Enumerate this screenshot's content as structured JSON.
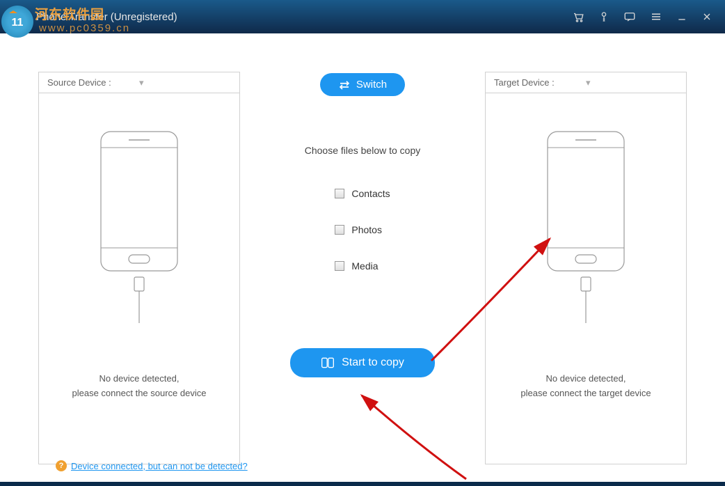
{
  "window": {
    "title": "Phone Transfer (Unregistered)"
  },
  "watermark": {
    "text": "河东软件园",
    "url": "www.pc0359.cn",
    "logoNum": "11"
  },
  "source": {
    "selectLabel": "Source Device :",
    "statusLine1": "No device detected,",
    "statusLine2": "please connect the source device"
  },
  "target": {
    "selectLabel": "Target Device :",
    "statusLine1": "No device detected,",
    "statusLine2": "please connect the target device"
  },
  "center": {
    "switchLabel": "Switch",
    "chooseLabel": "Choose files below to copy",
    "options": {
      "contacts": "Contacts",
      "photos": "Photos",
      "media": "Media"
    },
    "startLabel": "Start to copy"
  },
  "help": {
    "linkText": "Device connected, but can not be detected?"
  }
}
